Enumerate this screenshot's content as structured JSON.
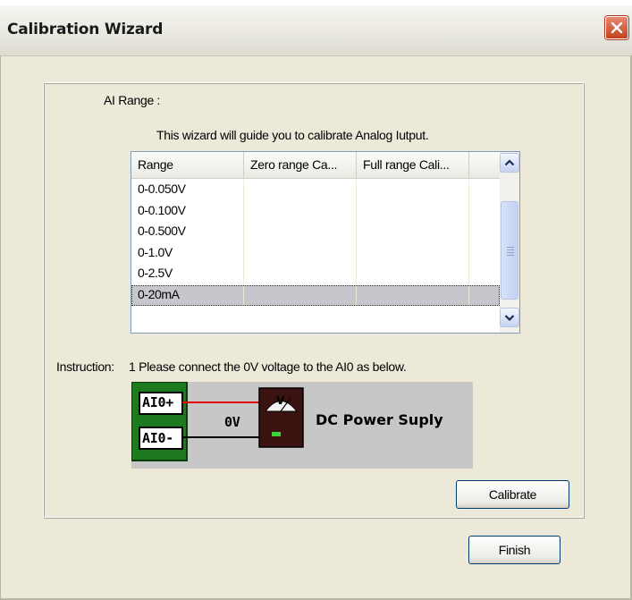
{
  "window": {
    "title": "Calibration Wizard"
  },
  "labels": {
    "ai_range": "AI Range :",
    "wizard_intro": "This wizard will guide you to calibrate Analog Iutput.",
    "instruction_label": "Instruction:",
    "instruction_text": "1 Please connect the 0V voltage to the AI0 as below."
  },
  "table": {
    "columns": [
      "Range",
      "Zero range Ca...",
      "Full range Cali..."
    ],
    "rows": [
      {
        "range": "0-0.050V",
        "zero": "",
        "full": ""
      },
      {
        "range": "0-0.100V",
        "zero": "",
        "full": ""
      },
      {
        "range": "0-0.500V",
        "zero": "",
        "full": ""
      },
      {
        "range": "0-1.0V",
        "zero": "",
        "full": ""
      },
      {
        "range": "0-2.5V",
        "zero": "",
        "full": ""
      },
      {
        "range": "0-20mA",
        "zero": "",
        "full": ""
      }
    ],
    "selected_row": 5
  },
  "diagram": {
    "plus_label": "AI0+",
    "minus_label": "AI0-",
    "voltage": "0V",
    "meter_symbol": "V",
    "supply_label": "DC Power Suply"
  },
  "buttons": {
    "calibrate": "Calibrate",
    "finish": "Finish"
  },
  "icons": {
    "close": "close-icon",
    "up": "scroll-up-arrow-icon",
    "down": "scroll-down-arrow-icon",
    "meter": "voltmeter-icon"
  },
  "colors": {
    "board_green": "#1e7a1e",
    "wire_red": "#e00000",
    "close_red": "#c3411f",
    "diagram_bg": "#c7c7c7"
  }
}
